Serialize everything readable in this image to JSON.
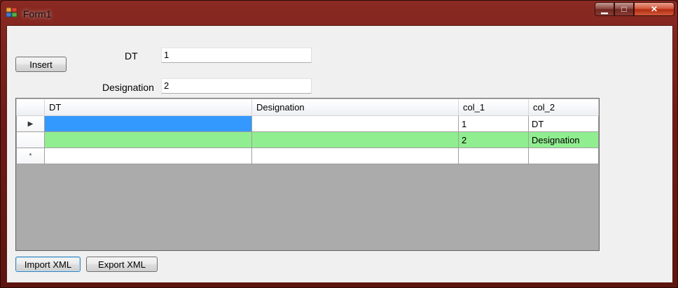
{
  "window": {
    "title": "Form1"
  },
  "caption": {
    "minimize": "▁",
    "maximize": "□",
    "close": "✕"
  },
  "toolbar": {
    "insert_label": "Insert",
    "import_label": "Import XML",
    "export_label": "Export XML"
  },
  "fields": {
    "dt_label": "DT",
    "dt_value": "1",
    "designation_label": "Designation",
    "designation_value": "2"
  },
  "grid": {
    "columns": [
      "DT",
      "Designation",
      "col_1",
      "col_2"
    ],
    "rows": [
      {
        "indicator": "▶",
        "cells": [
          "",
          "",
          "1",
          "DT"
        ]
      },
      {
        "indicator": "",
        "cells": [
          "",
          "",
          "2",
          "Designation"
        ]
      },
      {
        "indicator": "*",
        "cells": [
          "",
          "",
          "",
          ""
        ]
      }
    ]
  },
  "colors": {
    "selection": "#3399ff",
    "row_highlight": "#90ee90",
    "grid_background": "#ababab"
  }
}
